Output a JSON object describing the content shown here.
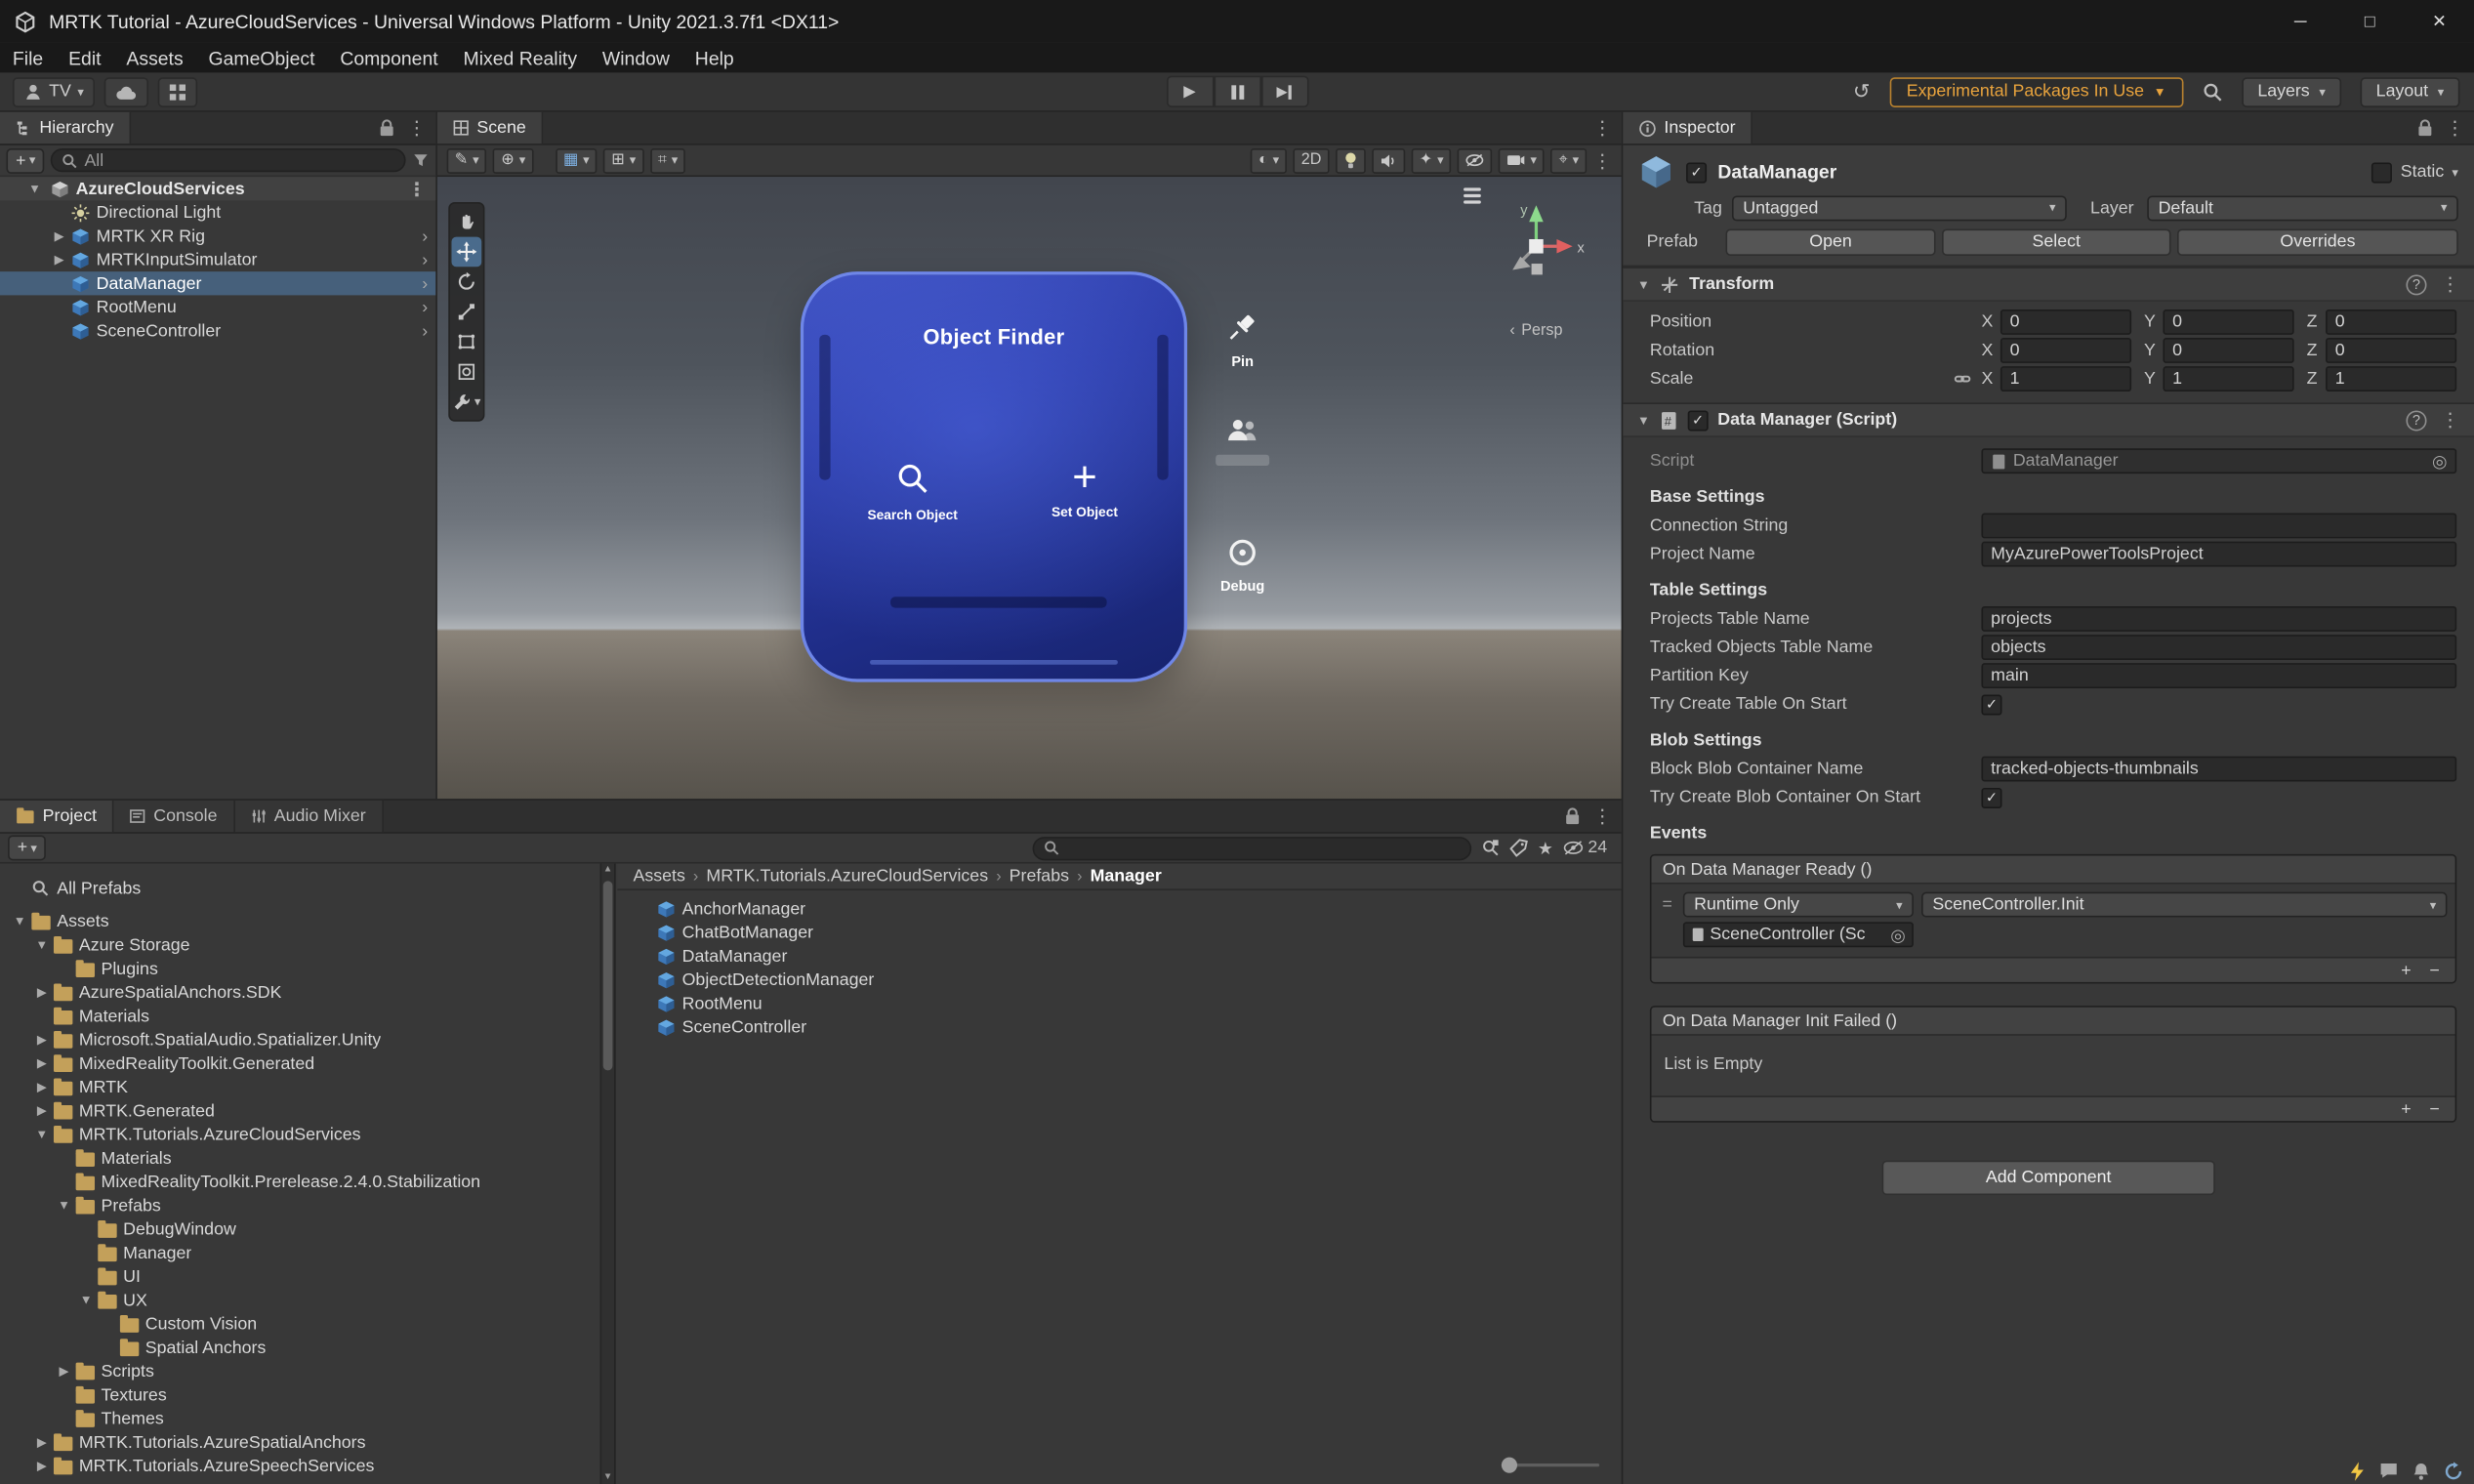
{
  "window": {
    "title": "MRTK Tutorial - AzureCloudServices - Universal Windows Platform - Unity 2021.3.7f1 <DX11>"
  },
  "menubar": {
    "items": [
      "File",
      "Edit",
      "Assets",
      "GameObject",
      "Component",
      "Mixed Reality",
      "Window",
      "Help"
    ]
  },
  "toolbar": {
    "account_label": "TV",
    "experimental_label": "Experimental Packages In Use",
    "layers_label": "Layers",
    "layout_label": "Layout"
  },
  "hierarchy": {
    "tab": "Hierarchy",
    "search_filter": "All",
    "scene_row": {
      "label": "AzureCloudServices"
    },
    "items": [
      {
        "label": "Directional Light",
        "icon": "light",
        "state": "none",
        "chevron": false
      },
      {
        "label": "MRTK XR Rig",
        "icon": "prefab",
        "state": "collapsed",
        "chevron": true
      },
      {
        "label": "MRTKInputSimulator",
        "icon": "prefab",
        "state": "collapsed",
        "chevron": true
      },
      {
        "label": "DataManager",
        "icon": "prefab",
        "state": "none",
        "chevron": true,
        "selected": true
      },
      {
        "label": "RootMenu",
        "icon": "prefab",
        "state": "none",
        "chevron": true
      },
      {
        "label": "SceneController",
        "icon": "prefab",
        "state": "none",
        "chevron": true
      }
    ]
  },
  "scene": {
    "tab": "Scene",
    "toolbar_2d": "2D",
    "persp_label": "Persp",
    "gizmo": {
      "x_label": "x",
      "y_label": "y"
    },
    "object_finder": {
      "title": "Object Finder",
      "search_button": "Search Object",
      "set_button": "Set Object"
    },
    "side_buttons": {
      "pin": "Pin",
      "debug": "Debug"
    }
  },
  "project": {
    "tabs": [
      {
        "label": "Project"
      },
      {
        "label": "Console"
      },
      {
        "label": "Audio Mixer"
      }
    ],
    "hidden_count": "24",
    "favorites": [
      {
        "label": "All Prefabs",
        "icon": "search",
        "indent": 0,
        "state": "none"
      }
    ],
    "tree": [
      {
        "label": "Assets",
        "icon": "folder",
        "indent": 0,
        "state": "expanded"
      },
      {
        "label": "Azure Storage",
        "icon": "folder",
        "indent": 1,
        "state": "expanded"
      },
      {
        "label": "Plugins",
        "icon": "folder",
        "indent": 2,
        "state": "none"
      },
      {
        "label": "AzureSpatialAnchors.SDK",
        "icon": "folder",
        "indent": 1,
        "state": "collapsed"
      },
      {
        "label": "Materials",
        "icon": "folder",
        "indent": 1,
        "state": "none"
      },
      {
        "label": "Microsoft.SpatialAudio.Spatializer.Unity",
        "icon": "folder",
        "indent": 1,
        "state": "collapsed"
      },
      {
        "label": "MixedRealityToolkit.Generated",
        "icon": "folder",
        "indent": 1,
        "state": "collapsed"
      },
      {
        "label": "MRTK",
        "icon": "folder",
        "indent": 1,
        "state": "collapsed"
      },
      {
        "label": "MRTK.Generated",
        "icon": "folder",
        "indent": 1,
        "state": "collapsed"
      },
      {
        "label": "MRTK.Tutorials.AzureCloudServices",
        "icon": "folder",
        "indent": 1,
        "state": "expanded"
      },
      {
        "label": "Materials",
        "icon": "folder",
        "indent": 2,
        "state": "none"
      },
      {
        "label": "MixedRealityToolkit.Prerelease.2.4.0.Stabilization",
        "icon": "folder",
        "indent": 2,
        "state": "none"
      },
      {
        "label": "Prefabs",
        "icon": "folder",
        "indent": 2,
        "state": "expanded"
      },
      {
        "label": "DebugWindow",
        "icon": "folder",
        "indent": 3,
        "state": "none"
      },
      {
        "label": "Manager",
        "icon": "folder",
        "indent": 3,
        "state": "none",
        "selected": true
      },
      {
        "label": "UI",
        "icon": "folder",
        "indent": 3,
        "state": "none"
      },
      {
        "label": "UX",
        "icon": "folder",
        "indent": 3,
        "state": "expanded"
      },
      {
        "label": "Custom Vision",
        "icon": "folder",
        "indent": 4,
        "state": "none"
      },
      {
        "label": "Spatial Anchors",
        "icon": "folder",
        "indent": 4,
        "state": "none"
      },
      {
        "label": "Scripts",
        "icon": "folder",
        "indent": 2,
        "state": "collapsed"
      },
      {
        "label": "Textures",
        "icon": "folder",
        "indent": 2,
        "state": "none"
      },
      {
        "label": "Themes",
        "icon": "folder",
        "indent": 2,
        "state": "none"
      },
      {
        "label": "MRTK.Tutorials.AzureSpatialAnchors",
        "icon": "folder",
        "indent": 1,
        "state": "collapsed"
      },
      {
        "label": "MRTK.Tutorials.AzureSpeechServices",
        "icon": "folder",
        "indent": 1,
        "state": "collapsed"
      }
    ],
    "breadcrumb": [
      "Assets",
      "MRTK.Tutorials.AzureCloudServices",
      "Prefabs",
      "Manager"
    ],
    "files": [
      {
        "label": "AnchorManager"
      },
      {
        "label": "ChatBotManager"
      },
      {
        "label": "DataManager"
      },
      {
        "label": "ObjectDetectionManager"
      },
      {
        "label": "RootMenu"
      },
      {
        "label": "SceneController"
      }
    ]
  },
  "inspector": {
    "tab": "Inspector",
    "name": "DataManager",
    "static_label": "Static",
    "tag_label": "Tag",
    "tag_value": "Untagged",
    "layer_label": "Layer",
    "layer_value": "Default",
    "prefab_label": "Prefab",
    "open": "Open",
    "select": "Select",
    "overrides": "Overrides",
    "transform": {
      "title": "Transform",
      "axis": [
        "X",
        "Y",
        "Z"
      ],
      "rows": [
        {
          "label": "Position",
          "x": "0",
          "y": "0",
          "z": "0"
        },
        {
          "label": "Rotation",
          "x": "0",
          "y": "0",
          "z": "0"
        },
        {
          "label": "Scale",
          "x": "1",
          "y": "1",
          "z": "1"
        }
      ]
    },
    "script_component": {
      "title": "Data Manager (Script)",
      "script_label": "Script",
      "script_value": "DataManager",
      "base_header": "Base Settings",
      "connection_label": "Connection String",
      "connection_value": "",
      "project_name_label": "Project Name",
      "project_name_value": "MyAzurePowerToolsProject",
      "table_header": "Table Settings",
      "projects_table_label": "Projects Table Name",
      "projects_table_value": "projects",
      "tracked_label": "Tracked Objects Table Name",
      "tracked_value": "objects",
      "partition_label": "Partition Key",
      "partition_value": "main",
      "try_table_label": "Try Create Table On Start",
      "blob_header": "Blob Settings",
      "blob_container_label": "Block Blob Container Name",
      "blob_container_value": "tracked-objects-thumbnails",
      "try_blob_label": "Try Create Blob Container On Start",
      "events_header": "Events",
      "event_ready": {
        "title": "On Data Manager Ready ()",
        "mode": "Runtime Only",
        "function": "SceneController.Init",
        "target": "SceneController (Sc"
      },
      "event_failed": {
        "title": "On Data Manager Init Failed ()",
        "empty": "List is Empty"
      }
    },
    "add_component": "Add Component"
  }
}
